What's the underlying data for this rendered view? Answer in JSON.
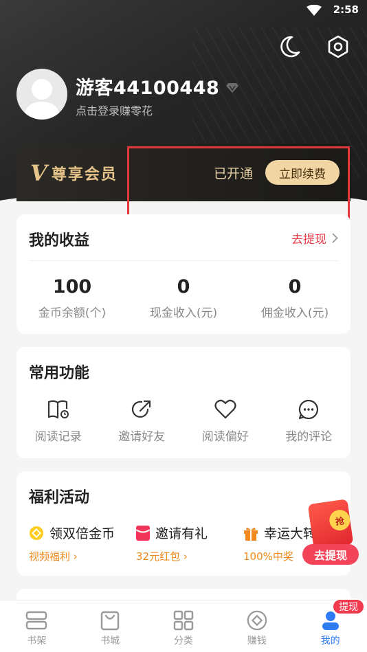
{
  "status_bar": {
    "time": "2:58"
  },
  "header": {
    "icons": [
      "moon-icon",
      "settings-icon"
    ]
  },
  "profile": {
    "username": "游客44100448",
    "login_hint": "点击登录赚零花"
  },
  "vip": {
    "logo_letter": "V",
    "label": "尊享会员",
    "status": "已开通",
    "renew_button": "立即续费"
  },
  "earnings": {
    "title": "我的收益",
    "withdraw_link": "去提现",
    "stats": [
      {
        "value": "100",
        "label": "金币余额(个)"
      },
      {
        "value": "0",
        "label": "现金收入(元)"
      },
      {
        "value": "0",
        "label": "佣金收入(元)"
      }
    ]
  },
  "functions": {
    "title": "常用功能",
    "items": [
      {
        "label": "阅读记录",
        "icon": "book-icon"
      },
      {
        "label": "邀请好友",
        "icon": "share-icon"
      },
      {
        "label": "阅读偏好",
        "icon": "heart-icon"
      },
      {
        "label": "我的评论",
        "icon": "comment-icon"
      }
    ]
  },
  "welfare": {
    "title": "福利活动",
    "items": [
      {
        "label": "领双倍金币",
        "sub": "视频福利",
        "icon": "coin-icon"
      },
      {
        "label": "邀请有礼",
        "sub": "32元红包",
        "icon": "envelope-icon"
      },
      {
        "label": "幸运大转盘",
        "sub": "100%中奖",
        "icon": "gift-icon"
      }
    ]
  },
  "float_redpacket": {
    "coin_text": "抢",
    "label": "去提现"
  },
  "tabbar": {
    "badge": "提现",
    "tabs": [
      {
        "label": "书架",
        "icon": "bookshelf-icon"
      },
      {
        "label": "书城",
        "icon": "store-icon"
      },
      {
        "label": "分类",
        "icon": "category-icon"
      },
      {
        "label": "赚钱",
        "icon": "earn-icon"
      },
      {
        "label": "我的",
        "icon": "profile-icon"
      }
    ],
    "active_tab": "我的",
    "active_color": "#2d7cf6"
  },
  "colors": {
    "accent_red": "#e8394a",
    "vip_gold": "#e6c48a",
    "welfare_orange": "#f08a1c"
  }
}
